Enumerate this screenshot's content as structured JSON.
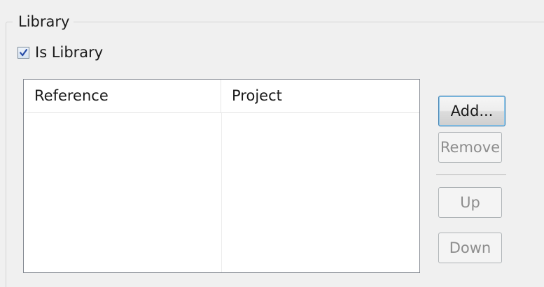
{
  "group": {
    "title": "Library"
  },
  "is_library": {
    "label": "Is Library",
    "checked": true
  },
  "table": {
    "columns": [
      "Reference",
      "Project"
    ],
    "rows": []
  },
  "buttons": {
    "add": "Add...",
    "remove": "Remove",
    "up": "Up",
    "down": "Down"
  },
  "colors": {
    "check_mark": "#2a4fa8",
    "default_button_border": "#3c7fb1",
    "disabled_text": "#8d8d8d"
  },
  "icons": {
    "checkbox": "checkmark-icon"
  }
}
